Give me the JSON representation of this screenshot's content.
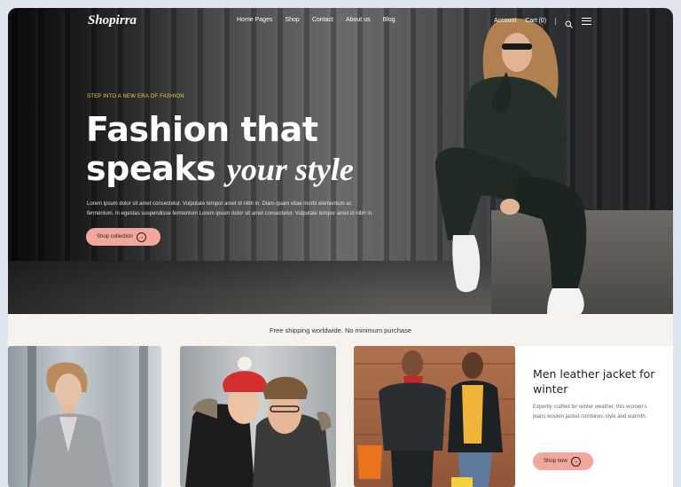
{
  "nav": {
    "logo": "Shopirra",
    "menu": [
      "Home Pages",
      "Shop",
      "Contact",
      "About us",
      "Blog"
    ],
    "account": "Account",
    "cart": "Cart (0)"
  },
  "hero": {
    "eyebrow": "STEP INTO A NEW ERA OF FASHION",
    "headline_line1": "Fashion that",
    "headline_line2": "speaks",
    "headline_script": "your style",
    "body_line1": "Lorem ipsum dolor sit amet consectetur. Vulputate tempor amet id nibh in. Diam quam vitae morbi elementum ac",
    "body_line2": "fermentum. In egestas suspendisse fermentum Lorem ipsum dolor sit amet consectetur. Vulputate tempor amet id nibh in.",
    "button": "Shop collection"
  },
  "shipping": "Free shipping worldwide. No minimum purchase",
  "promo": {
    "title": "Men leather jacket for winter",
    "text": "Expertly crafted for winter weather, this women's jeans woolen jacket combines style and warmth.",
    "button": "Shop now"
  },
  "colors": {
    "accent": "#f2a79c",
    "eyebrow": "#f1c94a",
    "page_bg": "#f6f2ee"
  },
  "icons": [
    "search-icon",
    "hamburger-menu-icon",
    "arrow-right-icon"
  ]
}
